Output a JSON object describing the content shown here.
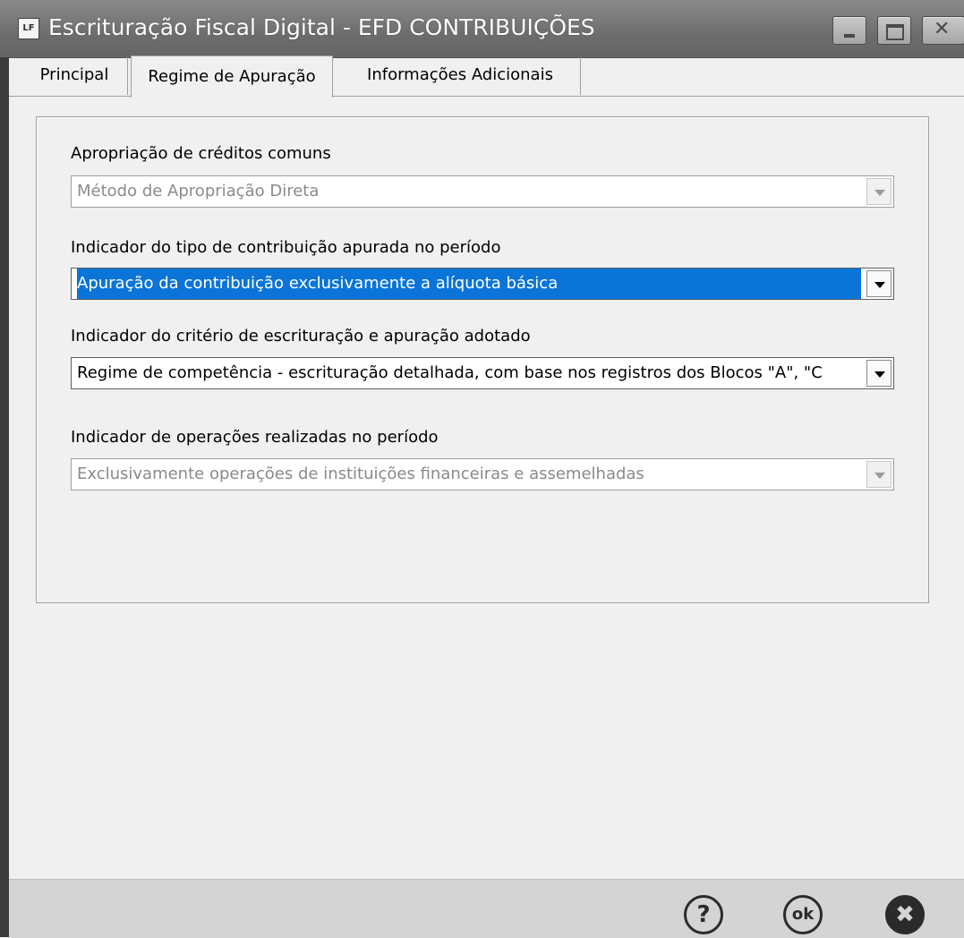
{
  "window": {
    "app_icon_text": "LF",
    "title": "Escrituração Fiscal Digital - EFD CONTRIBUIÇÕES",
    "controls": {
      "minimize": "minimize-icon",
      "maximize": "maximize-icon",
      "close": "close-icon"
    }
  },
  "tabs": [
    {
      "label": "Principal",
      "active": false
    },
    {
      "label": "Regime de Apuração",
      "active": true
    },
    {
      "label": "Informações Adicionais",
      "active": false
    }
  ],
  "fields": [
    {
      "label": "Apropriação de créditos comuns",
      "value": "Método de Apropriação Direta",
      "state": "disabled"
    },
    {
      "label": "Indicador do tipo de contribuição apurada no período",
      "value": "Apuração da contribuição exclusivamente a alíquota básica",
      "state": "selected"
    },
    {
      "label": "Indicador do critério de escrituração e apuração adotado",
      "value": "Regime de competência - escrituração detalhada, com base nos registros dos Blocos \"A\", \"C",
      "state": "enabled"
    },
    {
      "label": "Indicador de operações realizadas no período",
      "value": "Exclusivamente operações de instituições financeiras e assemelhadas",
      "state": "disabled"
    }
  ],
  "footer": {
    "help_label": "?",
    "ok_label": "ok",
    "cancel_label": "✖"
  }
}
